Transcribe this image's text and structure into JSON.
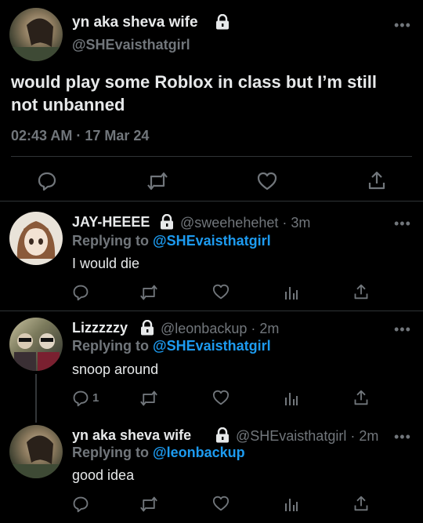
{
  "main_tweet": {
    "display_name": "yn aka sheva wife",
    "handle": "@SHEvaisthatgirl",
    "text": "would play some Roblox in class but I’m still not unbanned",
    "timestamp": "02:43 AM · 17 Mar 24"
  },
  "replies": [
    {
      "display_name": "JAY-HEEEE",
      "handle_time": "@sweehehehet · 3m",
      "replying_prefix": "Replying to",
      "replying_to": "@SHEvaisthatgirl",
      "text": "I would die",
      "reply_count": ""
    },
    {
      "display_name": "Lizzzzzy",
      "handle_time": "@leonbackup · 2m",
      "replying_prefix": "Replying to",
      "replying_to": "@SHEvaisthatgirl",
      "text": "snoop around",
      "reply_count": "1"
    },
    {
      "display_name": "yn aka sheva wife",
      "handle_time": "@SHEvaisthatgirl · 2m",
      "replying_prefix": "Replying to",
      "replying_to": "@leonbackup",
      "text": "good idea",
      "reply_count": ""
    }
  ],
  "colors": {
    "background": "#000000",
    "text": "#e7e9ea",
    "muted": "#71767b",
    "link": "#1d9bf0",
    "divider": "#2f3336"
  },
  "icons": [
    "lock-icon",
    "more-icon",
    "reply-icon",
    "retweet-icon",
    "like-icon",
    "views-icon",
    "share-icon"
  ]
}
